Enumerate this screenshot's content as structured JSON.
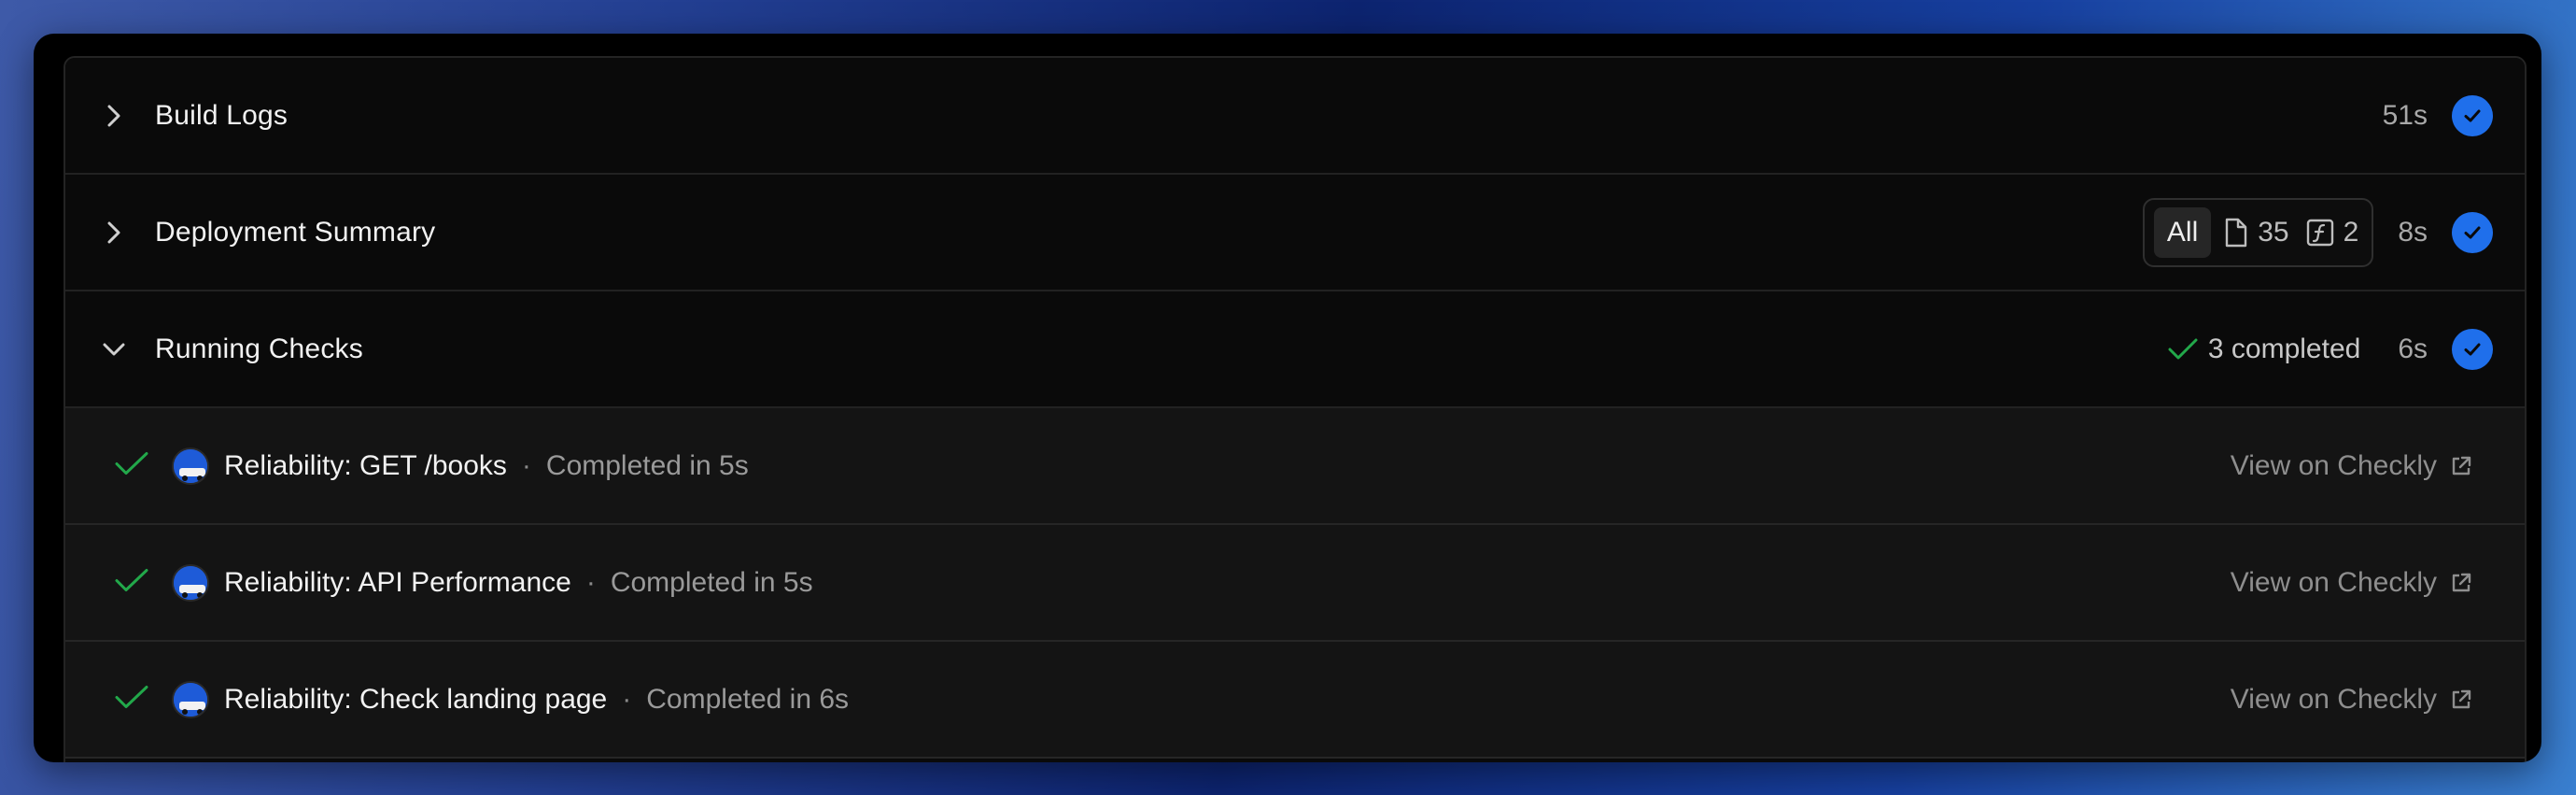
{
  "sections": [
    {
      "title": "Build Logs",
      "duration": "51s",
      "expanded": false
    },
    {
      "title": "Deployment Summary",
      "duration": "8s",
      "expanded": false,
      "filter": {
        "all_label": "All",
        "static_count": "35",
        "function_count": "2"
      }
    },
    {
      "title": "Running Checks",
      "duration": "6s",
      "expanded": true,
      "completed_label": "3 completed"
    }
  ],
  "checks": [
    {
      "name": "Reliability: GET /books",
      "status": "Completed in 5s",
      "link_label": "View on Checkly"
    },
    {
      "name": "Reliability: API Performance",
      "status": "Completed in 5s",
      "link_label": "View on Checkly"
    },
    {
      "name": "Reliability: Check landing page",
      "status": "Completed in 6s",
      "link_label": "View on Checkly"
    }
  ],
  "colors": {
    "accent": "#1f6feb",
    "success": "#22a84a"
  },
  "icons": {
    "collapsed": "chevron-right-icon",
    "expanded": "chevron-down-icon",
    "done": "check-circle-icon",
    "static_files": "file-icon",
    "functions": "function-icon",
    "external": "external-link-icon"
  }
}
